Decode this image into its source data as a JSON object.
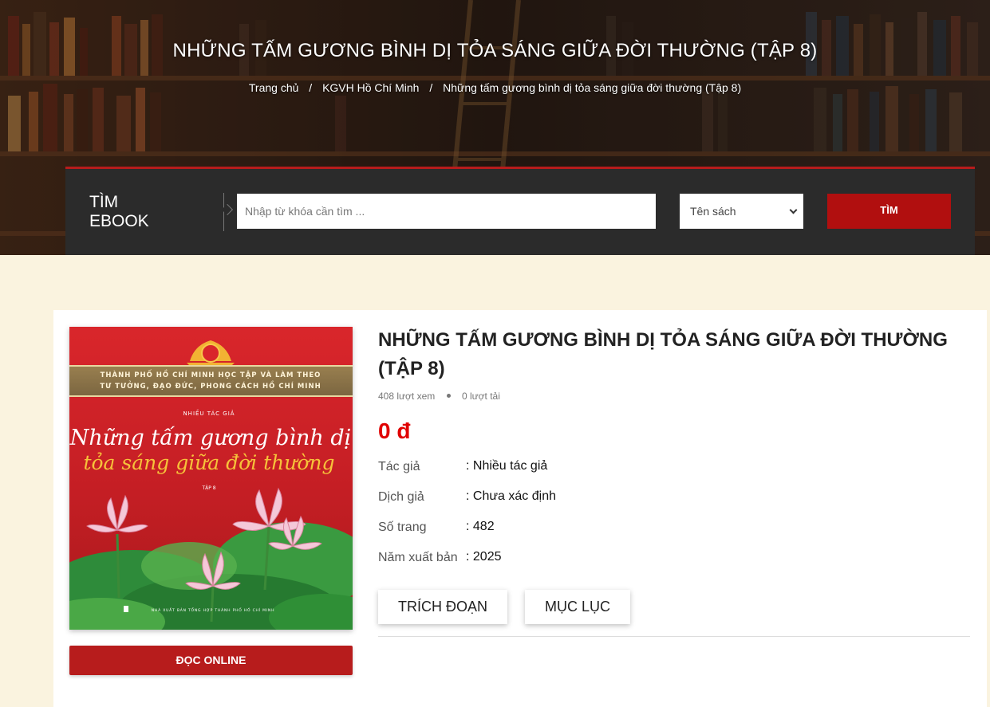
{
  "hero": {
    "title": "NHỮNG TẤM GƯƠNG BÌNH DỊ TỎA SÁNG GIỮA ĐỜI THƯỜNG (TẬP 8)",
    "breadcrumb": [
      "Trang chủ",
      "KGVH Hồ Chí Minh",
      "Những tấm gương bình dị tỏa sáng giữa đời thường (Tập 8)"
    ],
    "separator": "/"
  },
  "search": {
    "label_line1": "TÌM",
    "label_line2": "EBOOK",
    "placeholder": "Nhập từ khóa cần tìm ...",
    "select_value": "Tên sách",
    "button_label": "TÌM"
  },
  "cover": {
    "banner_line1": "THÀNH PHỐ HỒ CHÍ MINH HỌC TẬP VÀ LÀM THEO",
    "banner_line2": "TƯ TƯỞNG, ĐẠO ĐỨC, PHONG CÁCH HỒ CHÍ MINH",
    "author_small": "NHIỀU TÁC GIẢ",
    "title_line1": "Những tấm gương bình dị",
    "title_line2": "tỏa sáng giữa đời thường",
    "volume": "TẬP 8",
    "publisher": "NHÀ XUẤT BẢN TỔNG HỢP THÀNH PHỐ HỒ CHÍ MINH"
  },
  "book": {
    "title_line1": "NHỮNG TẤM GƯƠNG BÌNH DỊ TỎA SÁNG GIỮA ĐỜI THƯỜNG",
    "title_line2": "(TẬP 8)",
    "views": "408 lượt xem",
    "downloads": "0 lượt tải",
    "price": "0 đ",
    "meta": [
      {
        "label": "Tác giả",
        "value": ": Nhiều tác giả"
      },
      {
        "label": "Dịch giả",
        "value": ": Chưa xác định"
      },
      {
        "label": "Số trang",
        "value": ": 482"
      },
      {
        "label": "Năm xuất bản",
        "value": ": 2025"
      }
    ],
    "excerpt_label": "TRÍCH ĐOẠN",
    "toc_label": "MỤC LỤC",
    "read_online_label": "ĐỌC ONLINE"
  },
  "colors": {
    "accent": "#b71c1c",
    "price": "#e00000",
    "page_bg": "#faf3df",
    "search_bg": "#2b2b2b"
  }
}
